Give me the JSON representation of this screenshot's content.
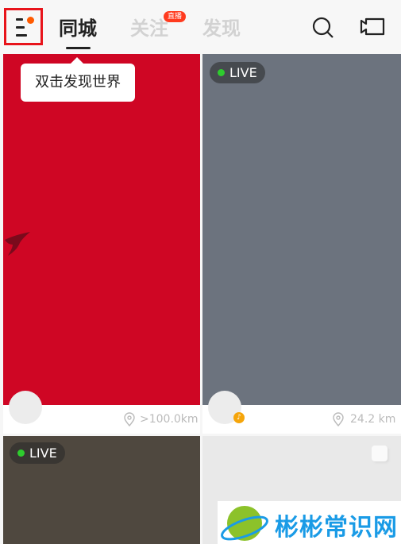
{
  "header": {
    "tabs": [
      {
        "label": "同城",
        "active": true
      },
      {
        "label": "关注",
        "active": false,
        "badge": "直播"
      },
      {
        "label": "发现",
        "active": false
      }
    ],
    "icons": [
      "menu-icon",
      "search-icon",
      "video-camera-icon"
    ]
  },
  "tooltip": "双击发现世界",
  "cards": [
    {
      "color": "#cf0624",
      "live": false,
      "distance": ">100.0km"
    },
    {
      "color": "#6c737e",
      "live": true,
      "live_label": "LIVE",
      "distance": "24.2 km"
    },
    {
      "color": "#4f483f",
      "live": true,
      "live_label": "LIVE"
    },
    {
      "color": "#e9e9e9",
      "live": false
    }
  ],
  "watermark": "彬彬常识网"
}
